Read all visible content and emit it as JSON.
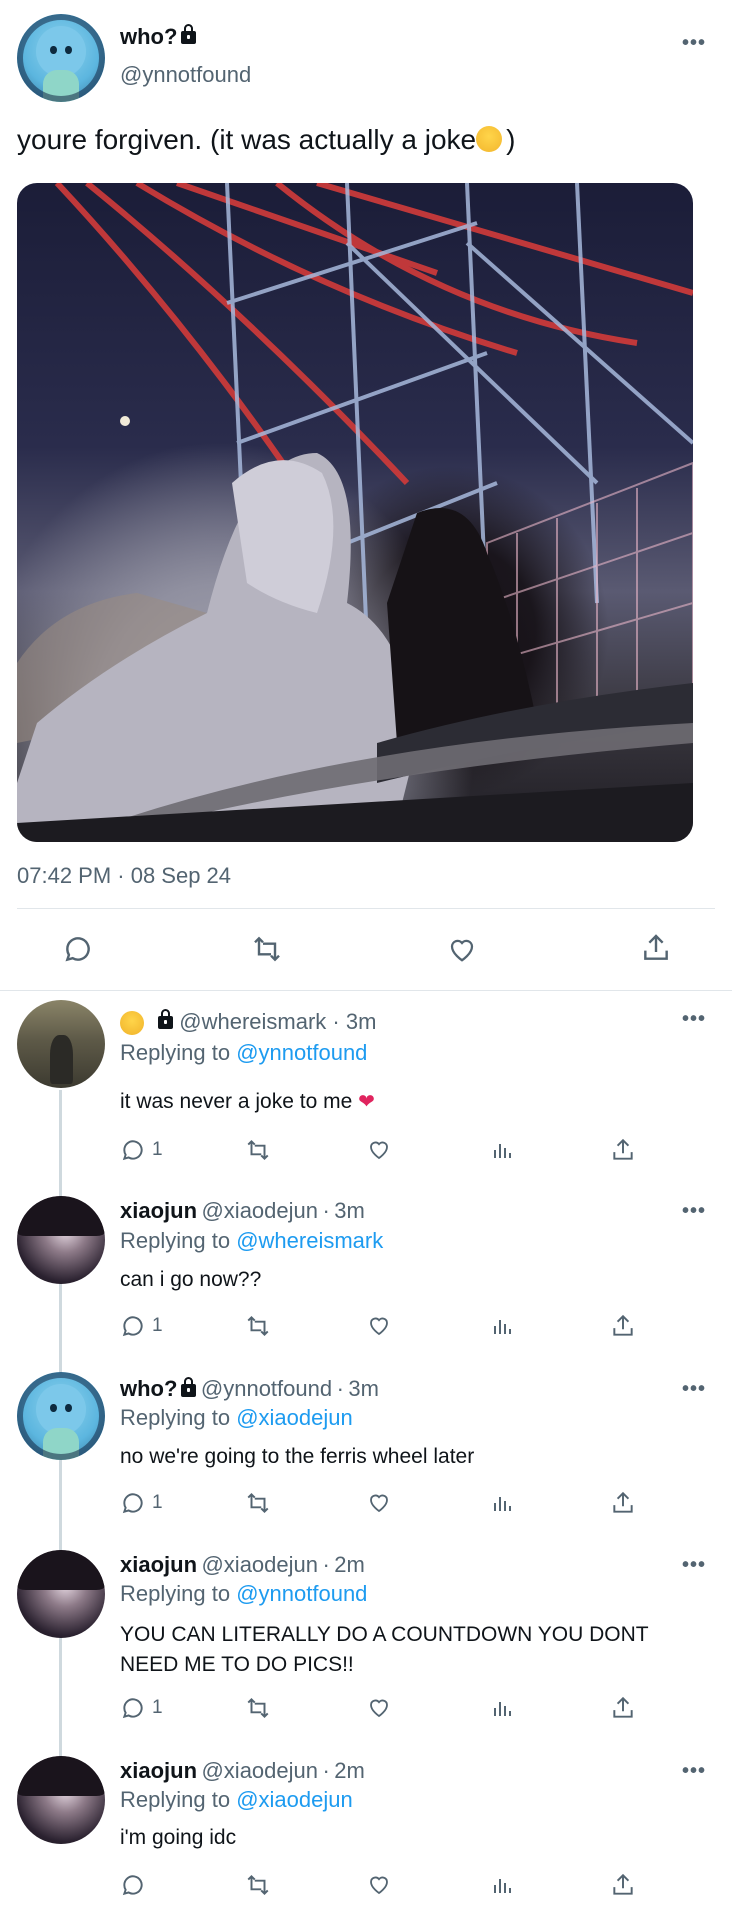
{
  "main_tweet": {
    "name": "who?",
    "handle": "@ynnotfound",
    "text_before": "youre forgiven. (it was actually a joke",
    "text_after": ")",
    "timestamp": "07:42 PM · 08 Sep 24",
    "image_alt": "",
    "more": "•••"
  },
  "replies": [
    {
      "name": "",
      "handle": "@whereismark",
      "time": "3m",
      "replying_label": "Replying to",
      "replying_to": "@ynnotfound",
      "text": "it was never a joke to me",
      "reply_count": "1",
      "more": "•••"
    },
    {
      "name": "xiaojun",
      "handle": "@xiaodejun",
      "time": "3m",
      "replying_label": "Replying to",
      "replying_to": "@whereismark",
      "text": "can i go now??",
      "reply_count": "1",
      "more": "•••"
    },
    {
      "name": "who?",
      "handle": "@ynnotfound",
      "time": "3m",
      "replying_label": "Replying to",
      "replying_to": "@xiaodejun",
      "text": "no we're going to the ferris wheel later",
      "reply_count": "1",
      "more": "•••"
    },
    {
      "name": "xiaojun",
      "handle": "@xiaodejun",
      "time": "2m",
      "replying_label": "Replying to",
      "replying_to": "@ynnotfound",
      "text": "YOU CAN LITERALLY DO A COUNTDOWN YOU DONT NEED ME TO DO PICS!!",
      "reply_count": "1",
      "more": "•••"
    },
    {
      "name": "xiaojun",
      "handle": "@xiaodejun",
      "time": "2m",
      "replying_label": "Replying to",
      "replying_to": "@xiaodejun",
      "text": "i'm going idc",
      "reply_count": "",
      "more": "•••"
    }
  ],
  "separator": "·",
  "colors": {
    "link": "#1d9bf0",
    "muted": "#536471",
    "divider": "#e1e6ea"
  }
}
